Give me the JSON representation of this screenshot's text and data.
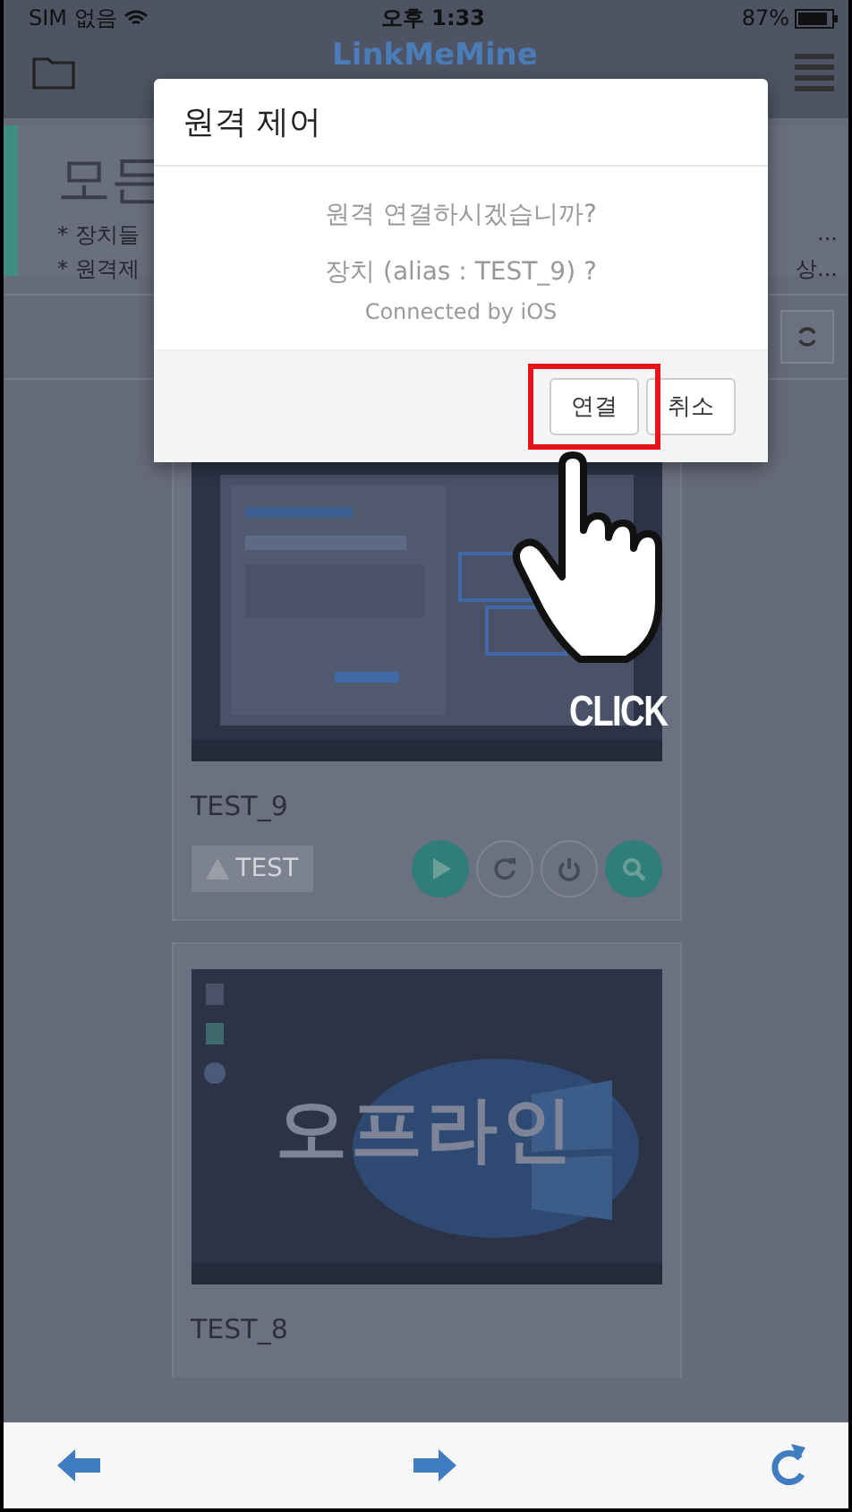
{
  "status_bar": {
    "carrier": "SIM 없음",
    "time": "오후 1:33",
    "battery": "87%"
  },
  "header": {
    "logo": "LinkMeMine"
  },
  "page": {
    "title": "모든",
    "notes": [
      {
        "left": "* 장치들",
        "right": "..."
      },
      {
        "left": "* 원격제",
        "right": "상..."
      }
    ]
  },
  "devices": [
    {
      "name": "TEST_9",
      "online": true,
      "tag": "TEST"
    },
    {
      "name": "TEST_8",
      "online": false,
      "offline_label": "오프라인"
    }
  ],
  "dialog": {
    "title": "원격 제어",
    "message": "원격 연결하시겠습니까?",
    "device_line": "장치 (alias : TEST_9) ?",
    "note": "Connected by iOS",
    "buttons": [
      {
        "label": "연결",
        "highlighted": true
      },
      {
        "label": "취소",
        "highlighted": false
      }
    ]
  },
  "callout": {
    "label": "CLICK"
  }
}
